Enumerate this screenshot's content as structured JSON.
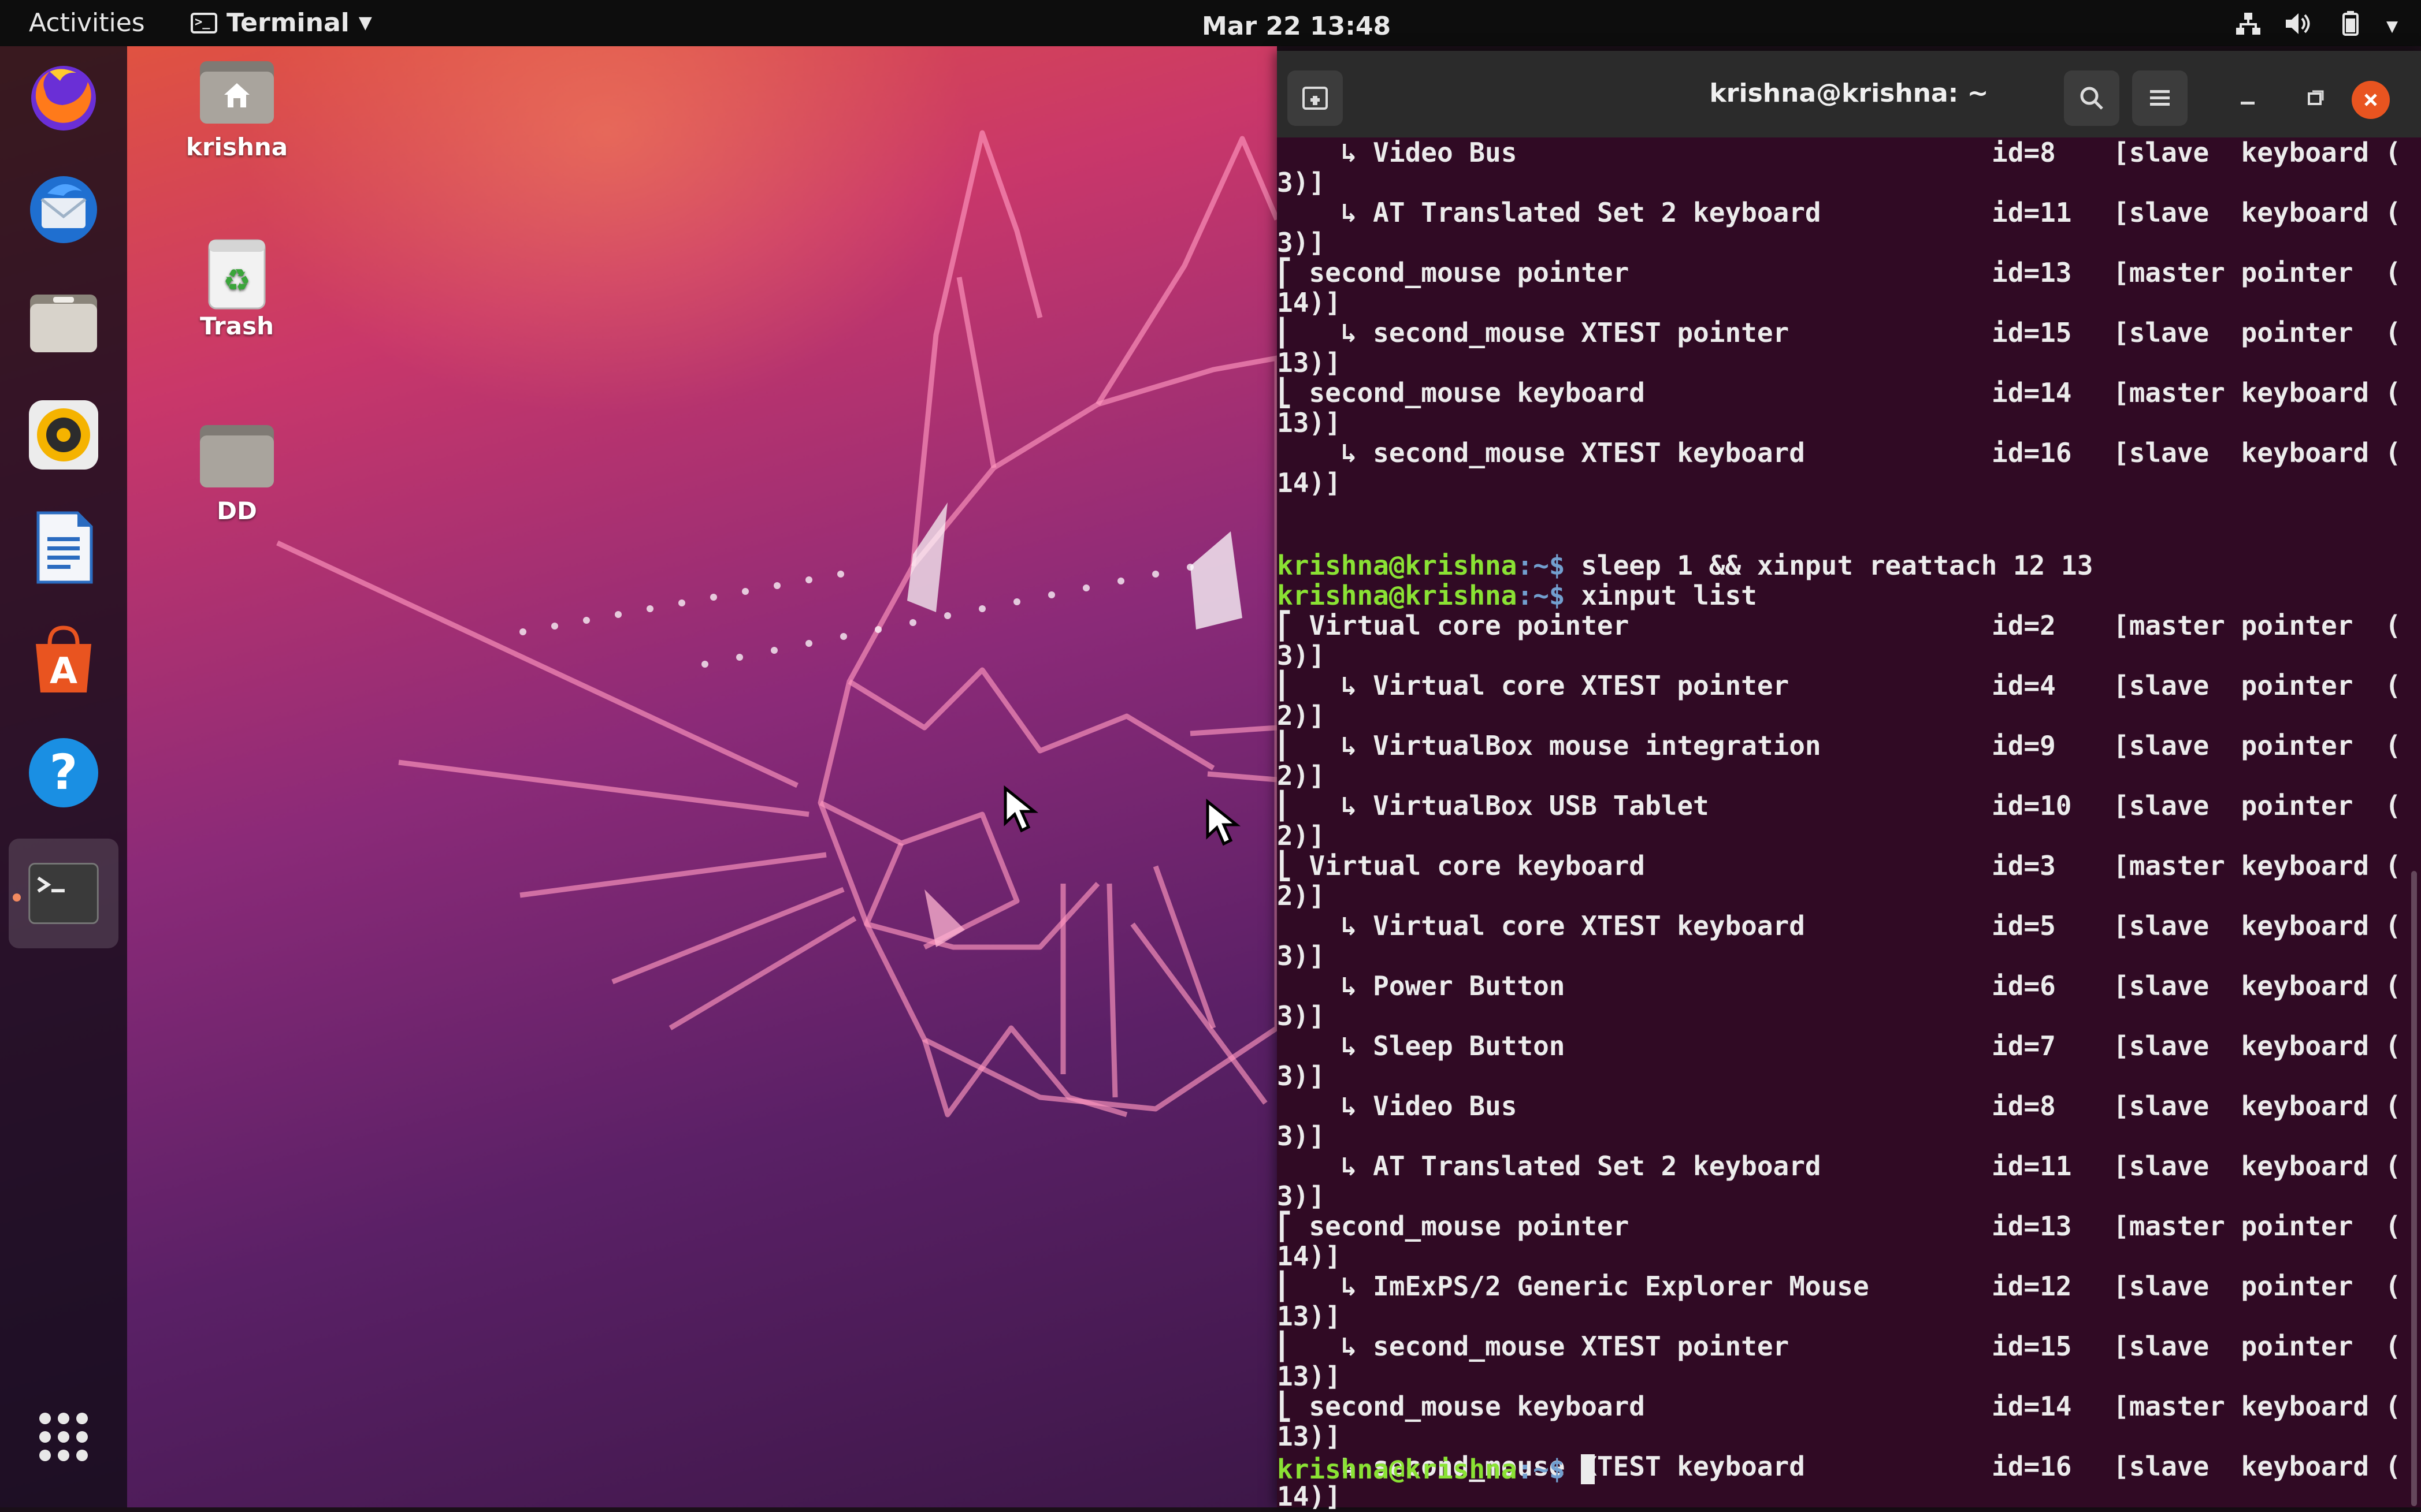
{
  "topbar": {
    "activities": "Activities",
    "app_menu": "Terminal",
    "clock": "Mar 22  13:48"
  },
  "desktop": {
    "icons": [
      {
        "label": "krishna",
        "icon": "home-folder-icon"
      },
      {
        "label": "Trash",
        "icon": "trash-icon"
      },
      {
        "label": "DD",
        "icon": "folder-icon"
      }
    ]
  },
  "dock": {
    "items": [
      "firefox-icon",
      "thunderbird-icon",
      "files-icon",
      "rhythmbox-icon",
      "libreoffice-writer-icon",
      "ubuntu-software-icon",
      "help-icon",
      "terminal-icon"
    ],
    "show_apps": "show-applications-icon"
  },
  "terminal": {
    "title": "krishna@krishna: ~",
    "prompt_user": "krishna@krishna",
    "prompt_sep": ":~$",
    "top_block": [
      {
        "name": "    ↳ Video Bus",
        "id": "id=8",
        "type": "[slave  keyboard (",
        "cont": "3)]"
      },
      {
        "name": "    ↳ AT Translated Set 2 keyboard",
        "id": "id=11",
        "type": "[slave  keyboard (",
        "cont": "3)]"
      },
      {
        "name": "⎡ second_mouse pointer",
        "id": "id=13",
        "type": "[master pointer  (",
        "cont": "14)]"
      },
      {
        "name": "⎜   ↳ second_mouse XTEST pointer",
        "id": "id=15",
        "type": "[slave  pointer  (",
        "cont": "13)]"
      },
      {
        "name": "⎣ second_mouse keyboard",
        "id": "id=14",
        "type": "[master keyboard (",
        "cont": "13)]"
      },
      {
        "name": "    ↳ second_mouse XTEST keyboard",
        "id": "id=16",
        "type": "[slave  keyboard (",
        "cont": "14)]"
      }
    ],
    "cmd1": " sleep 1 && xinput reattach 12 13",
    "cmd2": " xinput list",
    "list_block": [
      {
        "name": "⎡ Virtual core pointer",
        "id": "id=2",
        "type": "[master pointer  (",
        "cont": "3)]"
      },
      {
        "name": "⎜   ↳ Virtual core XTEST pointer",
        "id": "id=4",
        "type": "[slave  pointer  (",
        "cont": "2)]"
      },
      {
        "name": "⎜   ↳ VirtualBox mouse integration",
        "id": "id=9",
        "type": "[slave  pointer  (",
        "cont": "2)]"
      },
      {
        "name": "⎜   ↳ VirtualBox USB Tablet",
        "id": "id=10",
        "type": "[slave  pointer  (",
        "cont": "2)]"
      },
      {
        "name": "⎣ Virtual core keyboard",
        "id": "id=3",
        "type": "[master keyboard (",
        "cont": "2)]"
      },
      {
        "name": "    ↳ Virtual core XTEST keyboard",
        "id": "id=5",
        "type": "[slave  keyboard (",
        "cont": "3)]"
      },
      {
        "name": "    ↳ Power Button",
        "id": "id=6",
        "type": "[slave  keyboard (",
        "cont": "3)]"
      },
      {
        "name": "    ↳ Sleep Button",
        "id": "id=7",
        "type": "[slave  keyboard (",
        "cont": "3)]"
      },
      {
        "name": "    ↳ Video Bus",
        "id": "id=8",
        "type": "[slave  keyboard (",
        "cont": "3)]"
      },
      {
        "name": "    ↳ AT Translated Set 2 keyboard",
        "id": "id=11",
        "type": "[slave  keyboard (",
        "cont": "3)]"
      },
      {
        "name": "⎡ second_mouse pointer",
        "id": "id=13",
        "type": "[master pointer  (",
        "cont": "14)]"
      },
      {
        "name": "⎜   ↳ ImExPS/2 Generic Explorer Mouse",
        "id": "id=12",
        "type": "[slave  pointer  (",
        "cont": "13)]"
      },
      {
        "name": "⎜   ↳ second_mouse XTEST pointer",
        "id": "id=15",
        "type": "[slave  pointer  (",
        "cont": "13)]"
      },
      {
        "name": "⎣ second_mouse keyboard",
        "id": "id=14",
        "type": "[master keyboard (",
        "cont": "13)]"
      },
      {
        "name": "    ↳ second_mouse XTEST keyboard",
        "id": "id=16",
        "type": "[slave  keyboard (",
        "cont": "14)]"
      }
    ]
  }
}
